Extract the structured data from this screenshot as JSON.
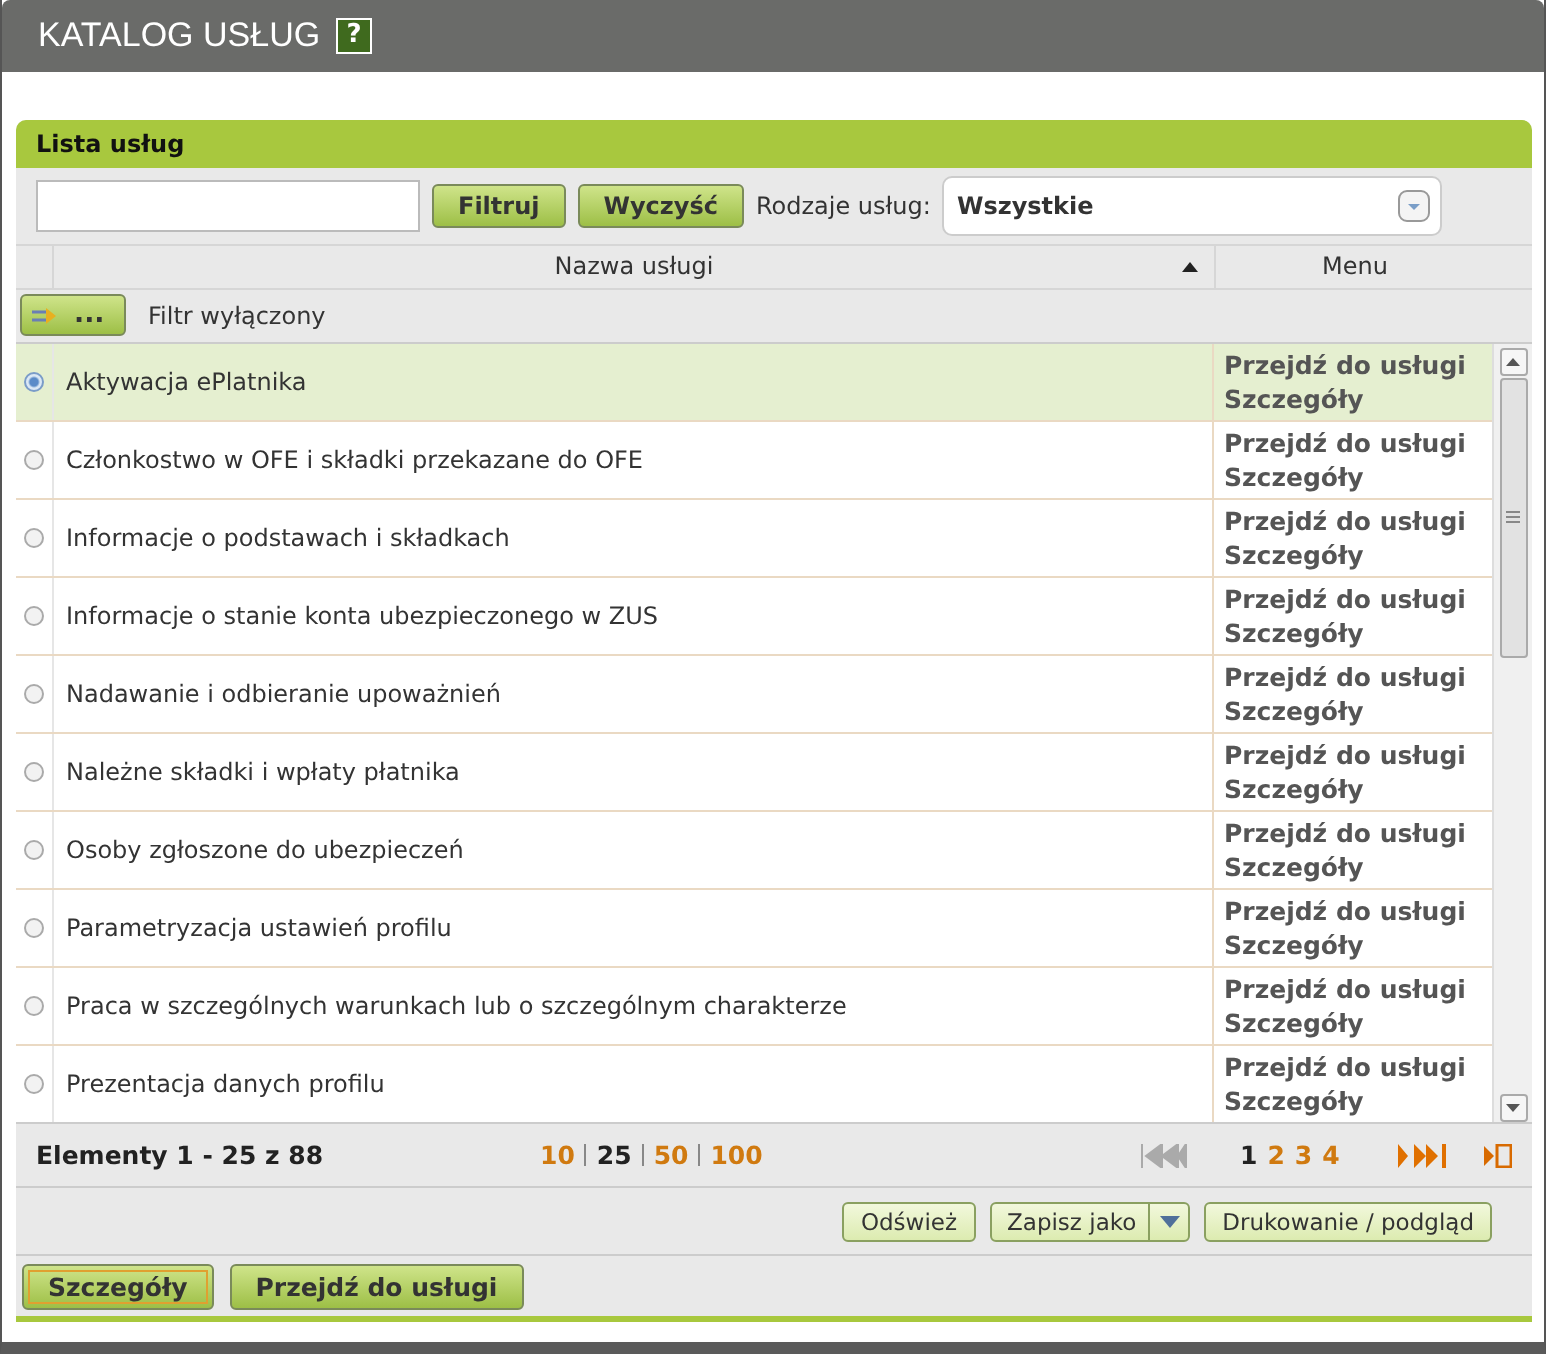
{
  "window": {
    "title": "KATALOG USŁUG",
    "help": "?"
  },
  "panel": {
    "title": "Lista usług"
  },
  "filter": {
    "buttons": [
      "Filtruj",
      "Wyczyść"
    ],
    "type_label": "Rodzaje usług:",
    "type_value": "Wszystkie"
  },
  "table": {
    "columns": [
      {
        "label": "Nazwa usługi",
        "sorted": true
      },
      {
        "label": "Menu",
        "sorted": false
      }
    ],
    "filter_button": "...",
    "filter_status": "Filtr wyłączony",
    "rows": [
      {
        "name": "Aktywacja ePlatnika",
        "selected": true,
        "links": [
          "Przejdź do usługi",
          "Szczegóły"
        ]
      },
      {
        "name": "Członkostwo w OFE i składki przekazane do OFE",
        "selected": false,
        "links": [
          "Przejdź do usługi",
          "Szczegóły"
        ]
      },
      {
        "name": "Informacje o podstawach i składkach",
        "selected": false,
        "links": [
          "Przejdź do usługi",
          "Szczegóły"
        ]
      },
      {
        "name": "Informacje o stanie konta ubezpieczonego w ZUS",
        "selected": false,
        "links": [
          "Przejdź do usługi",
          "Szczegóły"
        ]
      },
      {
        "name": "Nadawanie i odbieranie upoważnień",
        "selected": false,
        "links": [
          "Przejdź do usługi",
          "Szczegóły"
        ]
      },
      {
        "name": "Należne składki i wpłaty płatnika",
        "selected": false,
        "links": [
          "Przejdź do usługi",
          "Szczegóły"
        ]
      },
      {
        "name": "Osoby zgłoszone do ubezpieczeń",
        "selected": false,
        "links": [
          "Przejdź do usługi",
          "Szczegóły"
        ]
      },
      {
        "name": "Parametryzacja ustawień profilu",
        "selected": false,
        "links": [
          "Przejdź do usługi",
          "Szczegóły"
        ]
      },
      {
        "name": "Praca w szczególnych warunkach lub o szczególnym charakterze",
        "selected": false,
        "links": [
          "Przejdź do usługi",
          "Szczegóły"
        ]
      },
      {
        "name": "Prezentacja danych profilu",
        "selected": false,
        "links": [
          "Przejdź do usługi",
          "Szczegóły"
        ]
      }
    ]
  },
  "pager": {
    "summary": "Elementy 1 - 25 z 88",
    "page_sizes": [
      {
        "label": "10",
        "selected": false
      },
      {
        "label": "25",
        "selected": true
      },
      {
        "label": "50",
        "selected": false
      },
      {
        "label": "100",
        "selected": false
      }
    ],
    "nav_back": {
      "disabled": true
    },
    "pages": [
      {
        "label": "1",
        "selected": true
      },
      {
        "label": "2",
        "selected": false
      },
      {
        "label": "3",
        "selected": false
      },
      {
        "label": "4",
        "selected": false
      }
    ],
    "nav_forward": {
      "disabled": false
    }
  },
  "toolbar": [
    {
      "label": "Odśwież",
      "kind": "plain"
    },
    {
      "label": "Zapisz jako",
      "kind": "dropdown"
    },
    {
      "label": "Drukowanie / podgląd",
      "kind": "plain"
    }
  ],
  "actions": [
    {
      "label": "Szczegóły",
      "focused": true
    },
    {
      "label": "Przejdź do usługi",
      "focused": false
    }
  ]
}
